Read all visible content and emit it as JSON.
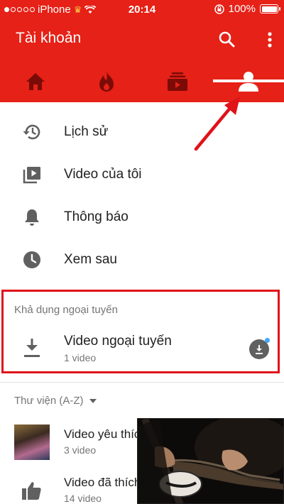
{
  "status_bar": {
    "carrier": "iPhone",
    "time": "20:14",
    "battery": "100%"
  },
  "app_bar": {
    "title": "Tài khoản",
    "tabs": [
      {
        "name": "home",
        "icon": "home-icon",
        "active": false
      },
      {
        "name": "trending",
        "icon": "flame-icon",
        "active": false
      },
      {
        "name": "subscriptions",
        "icon": "subscriptions-icon",
        "active": false
      },
      {
        "name": "account",
        "icon": "person-icon",
        "active": true
      }
    ]
  },
  "menu": [
    {
      "label": "Lịch sử",
      "icon": "history-icon"
    },
    {
      "label": "Video của tôi",
      "icon": "my-videos-icon"
    },
    {
      "label": "Thông báo",
      "icon": "bell-icon"
    },
    {
      "label": "Xem sau",
      "icon": "clock-icon"
    }
  ],
  "offline": {
    "header": "Khả dụng ngoại tuyến",
    "title": "Video ngoại tuyến",
    "subtitle": "1 video"
  },
  "library": {
    "header": "Thư viện (A-Z)",
    "items": [
      {
        "title": "Video yêu thích",
        "count": "3 video"
      },
      {
        "title": "Video đã thích",
        "count": "14 video"
      }
    ]
  },
  "colors": {
    "brand_red": "#e62117",
    "annotation_red": "#e0121a"
  }
}
